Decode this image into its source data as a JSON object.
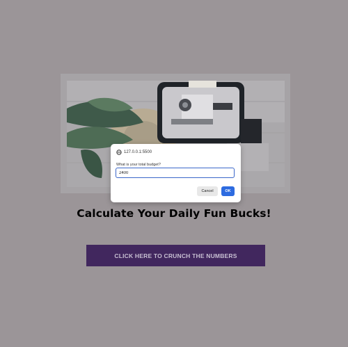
{
  "page": {
    "title": "Calculate Your Daily Fun Bucks!",
    "cta_label": "CLICK HERE TO CRUNCH THE NUMBERS",
    "hero_image_subject": "suitcase-with-travel-items-and-plant-photo"
  },
  "dialog": {
    "origin": "127.0.0.1:5500",
    "origin_icon": "globe-icon",
    "message": "What is your total budget?",
    "input_value": "2400",
    "cancel_label": "Cancel",
    "ok_label": "OK"
  },
  "colors": {
    "overlay_background": "#9b9598",
    "cta_background": "#41275e",
    "cta_text": "#c7bfd2",
    "ok_button": "#2d6be0",
    "input_border": "#3a66c9"
  }
}
